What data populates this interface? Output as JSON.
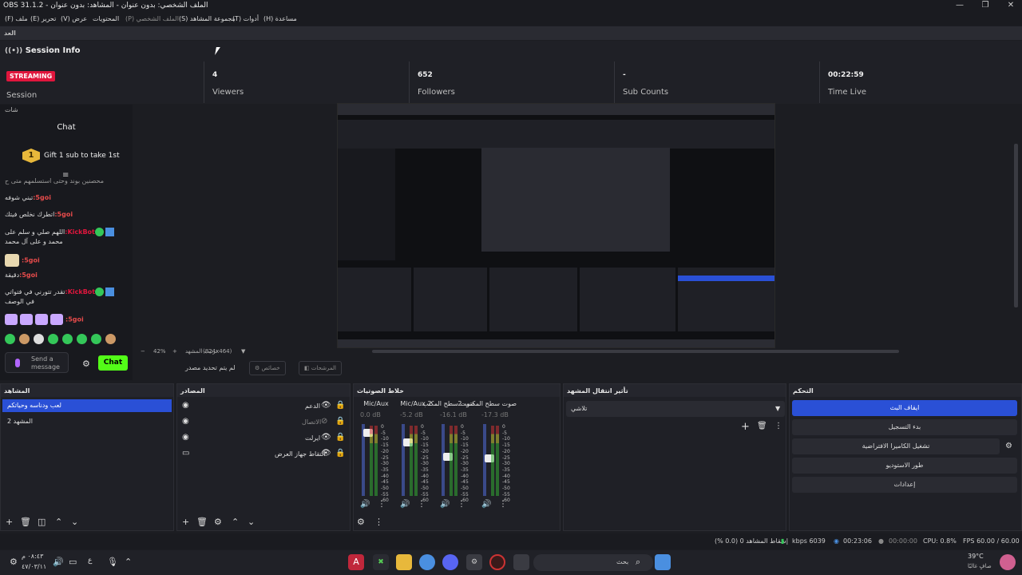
{
  "window": {
    "title": "OBS 31.1.2 - الملف الشخصي: بدون عنوان - المشاهد: بدون عنوان"
  },
  "menu": [
    "ملف (F)",
    "تحرير (E)",
    "عرض (V)",
    "المحتويات",
    "الملف الشخصي (P)",
    "مجموعة المشاهد (S)",
    "أدوات (T)",
    "مساعدة (H)"
  ],
  "dock_label": "العد",
  "session": {
    "header": "Session Info",
    "badge": "STREAMING",
    "session_label": "Session",
    "stats": [
      {
        "value": "4",
        "label": "Viewers"
      },
      {
        "value": "652",
        "label": "Followers"
      },
      {
        "value": "-",
        "label": "Sub Counts"
      },
      {
        "value": "00:22:59",
        "label": "Time Live"
      }
    ]
  },
  "chat": {
    "dock_title": "شات",
    "title": "Chat",
    "gift_count": "1",
    "gift_text": "Gift 1 sub to take 1st",
    "messages": [
      {
        "user": "",
        "text": "محصنين بوند وحتى استسلمهم متى ح"
      },
      {
        "user": "5goi:",
        "text": "تبني شوفه"
      },
      {
        "user": "5goi:",
        "text": "اتطرك نخلص فيتك"
      },
      {
        "user": "KickBot:",
        "text": "اللهم صلي و سلم على محمد و على آل محمد"
      },
      {
        "user": "5goi:",
        "text": ""
      },
      {
        "user": "5goi:",
        "text": "دقيقة"
      },
      {
        "user": "KickBot:",
        "text": "تقدر تتورني في فتواتي في الوصف"
      },
      {
        "user": "5goi:",
        "text": ""
      }
    ],
    "send_placeholder": "Send a message",
    "send_button": "Chat"
  },
  "preview": {
    "zoom": "42%",
    "resolution": "(824x464)",
    "source_label": "ترتيب المشهد"
  },
  "source_toolbar": {
    "no_source": "لم يتم تحديد مصدر",
    "properties": "خصائص",
    "filters": "المرشحات"
  },
  "scenes": {
    "title": "المشاهد",
    "items": [
      "لعب ودناسه وحياتكم",
      "المشهد 2"
    ]
  },
  "sources": {
    "title": "المصادر",
    "items": [
      "الدعم",
      "الاتصال",
      "ايرلت",
      "التقاط جهاز العرض"
    ]
  },
  "mixer": {
    "title": "خلاط الصوتيات",
    "channels": [
      {
        "name": "Mic/Aux",
        "db": "0.0 dB",
        "level": 0.93
      },
      {
        "name": "Mic/Aux 2",
        "db": "-5.2 dB",
        "level": 0.78
      },
      {
        "name": "صوت سطح المكتب",
        "db": "-16.1 dB",
        "level": 0.55
      },
      {
        "name": "صوت سطح المكتب 2",
        "db": "-17.3 dB",
        "level": 0.52
      }
    ],
    "scale": [
      "0",
      "-5",
      "-10",
      "-15",
      "-20",
      "-25",
      "-30",
      "-35",
      "-40",
      "-45",
      "-50",
      "-55",
      "-60"
    ]
  },
  "transitions": {
    "title": "تأثير انتقال المشهد",
    "selected": "تلاشي"
  },
  "controls": {
    "title": "التحكم",
    "buttons": [
      "ايقاف البث",
      "بدء التسجيل",
      "تشغيل الكاميرا الافتراضية",
      "طور الاستوديو",
      "إعدادات"
    ]
  },
  "status": {
    "dropped": "إسقاط المشاهد 0 (0.0 %)",
    "bitrate": "6039 kbps",
    "live_time": "00:23:06",
    "rec_time": "00:00:00",
    "cpu": "CPU: 0.8%",
    "fps": "60.00 / 60.00 FPS"
  },
  "taskbar": {
    "time": "٠٨:٤٣ م",
    "date": "٤٧/٠٣/١١",
    "lang": "ع",
    "search": "بحث",
    "weather_temp": "39°C",
    "weather_desc": "صافٍ غالبًا"
  }
}
